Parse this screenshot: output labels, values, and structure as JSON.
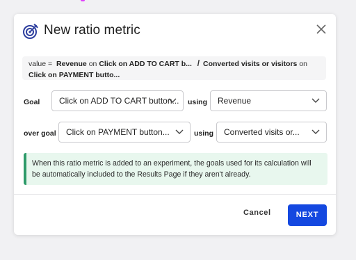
{
  "dialog": {
    "title": "New ratio metric",
    "icon": "target-icon",
    "close_icon": "close-icon"
  },
  "formula": {
    "prefix": "value =",
    "numerator_metric": "Revenue",
    "on1": "on",
    "numerator_goal": "Click on ADD TO CART b...",
    "slash": "/",
    "denominator_metric": "Converted visits or visitors",
    "on2": "on",
    "denominator_goal": "Click on PAYMENT butto..."
  },
  "goal_row": {
    "label": "Goal",
    "goal_value": "Click on ADD TO CART button...",
    "using_label": "using",
    "metric_value": "Revenue"
  },
  "over_goal_row": {
    "label": "over goal",
    "goal_value": "Click on PAYMENT button...",
    "using_label": "using",
    "metric_value": "Converted visits or..."
  },
  "info": {
    "text": "When this ratio metric is added to an experiment, the goals used for its calculation will be automatically included to the Results Page if they aren't already.",
    "accent_color": "#2e9b6a",
    "background_color": "#e8f7ee"
  },
  "footer": {
    "cancel_label": "Cancel",
    "next_label": "NEXT",
    "primary_color": "#1448e0"
  }
}
